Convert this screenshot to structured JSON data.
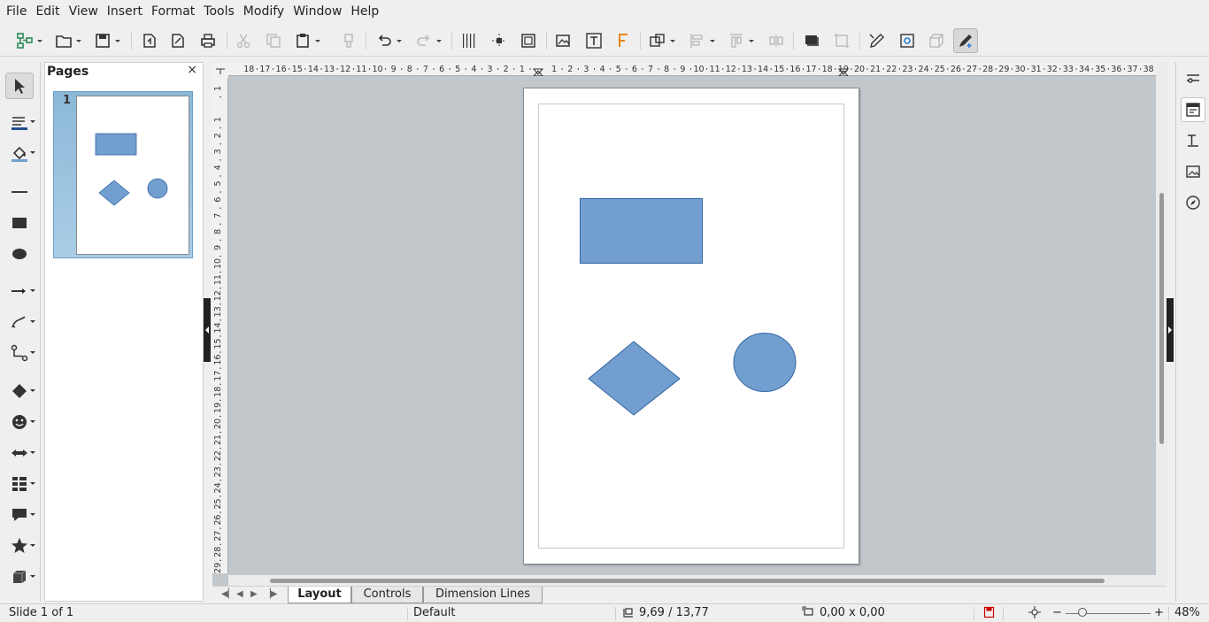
{
  "menubar": {
    "items": [
      {
        "label": "File"
      },
      {
        "label": "Edit"
      },
      {
        "label": "View"
      },
      {
        "label": "Insert"
      },
      {
        "label": "Format"
      },
      {
        "label": "Tools"
      },
      {
        "label": "Modify"
      },
      {
        "label": "Window"
      },
      {
        "label": "Help"
      }
    ]
  },
  "pages_panel": {
    "title": "Pages",
    "close_glyph": "×",
    "thumbnails": [
      {
        "number": "1"
      }
    ]
  },
  "colors": {
    "shape_fill": "#729fcf",
    "shape_stroke": "#3465a4",
    "canvas_bg": "#c2c7cc",
    "thumb_selected": "#a9cde6"
  },
  "ruler": {
    "h_labels": [
      "18",
      "17",
      "16",
      "15",
      "14",
      "13",
      "12",
      "11",
      "10",
      "9",
      "8",
      "7",
      "6",
      "5",
      "4",
      "3",
      "2",
      "1",
      "1",
      "2",
      "3",
      "4",
      "5",
      "6",
      "7",
      "8",
      "9",
      "10",
      "11",
      "12",
      "13",
      "14",
      "15",
      "16",
      "17",
      "18",
      "19",
      "20",
      "21",
      "22",
      "23",
      "24",
      "25",
      "26",
      "27",
      "28",
      "29",
      "30",
      "31",
      "32",
      "33",
      "34",
      "35",
      "36",
      "37",
      "38"
    ],
    "v_labels": [
      "1",
      "1",
      "2",
      "3",
      "4",
      "5",
      "6",
      "7",
      "8",
      "9",
      "10",
      "11",
      "12",
      "13",
      "14",
      "15",
      "16",
      "17",
      "18",
      "19",
      "20",
      "21",
      "22",
      "23",
      "24",
      "25",
      "26",
      "27",
      "28",
      "29"
    ]
  },
  "document": {
    "shapes": [
      {
        "type": "rectangle",
        "name": "rectangle-shape"
      },
      {
        "type": "diamond",
        "name": "diamond-shape"
      },
      {
        "type": "ellipse",
        "name": "circle-shape"
      }
    ]
  },
  "tabs": {
    "items": [
      {
        "label": "Layout",
        "active": true
      },
      {
        "label": "Controls",
        "active": false
      },
      {
        "label": "Dimension Lines",
        "active": false
      }
    ]
  },
  "statusbar": {
    "slide": "Slide 1 of 1",
    "master": "Default",
    "position": "9,69 / 13,77",
    "size": "0,00 x 0,00",
    "zoom_minus": "−",
    "zoom_plus": "+",
    "zoom": "48%"
  },
  "toolbar": {
    "icons": [
      "new-icon",
      "open-icon",
      "save-icon",
      "export-icon",
      "export-pdf-icon",
      "print-icon",
      "cut-icon",
      "copy-icon",
      "paste-icon",
      "clone-formatting-icon",
      "undo-icon",
      "redo-icon",
      "grid-icon",
      "helplines-icon",
      "zoom-page-icon",
      "insert-image-icon",
      "insert-textbox-icon",
      "fontwork-icon",
      "transformations-icon",
      "align-icon",
      "arrange-icon",
      "distribute-icon",
      "shadow-icon",
      "crop-icon",
      "points-icon",
      "glue-points-icon",
      "toggle-extrusion-icon",
      "show-draw-functions-icon"
    ]
  },
  "left_tools": {
    "icons": [
      "select-icon",
      "line-color-icon",
      "fill-color-icon",
      "line-icon",
      "rectangle-icon",
      "ellipse-icon",
      "lines-arrows-icon",
      "curves-polygons-icon",
      "connectors-icon",
      "basic-shapes-icon",
      "symbol-shapes-icon",
      "block-arrows-icon",
      "flowchart-icon",
      "callouts-icon",
      "stars-icon",
      "3d-objects-icon"
    ]
  },
  "right_sidebar": {
    "icons": [
      "properties-icon",
      "page-icon",
      "styles-icon",
      "gallery-icon",
      "navigator-icon"
    ]
  }
}
